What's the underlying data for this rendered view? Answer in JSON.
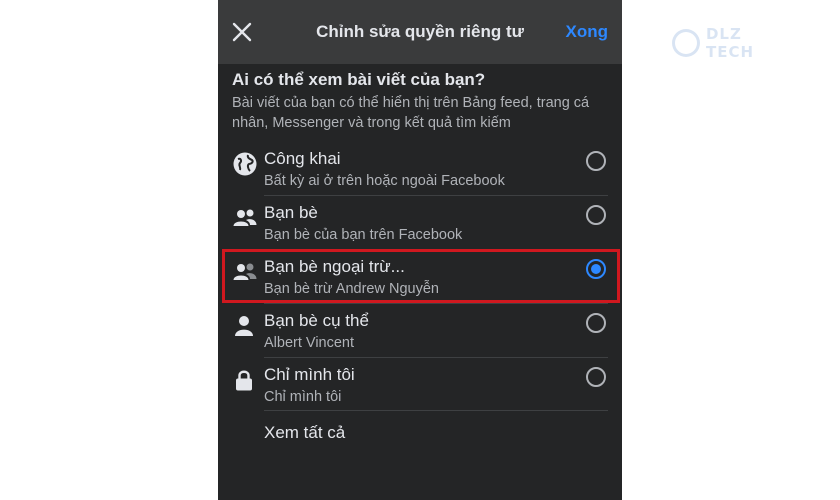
{
  "header": {
    "title": "Chỉnh sửa quyền riêng tư",
    "done_label": "Xong"
  },
  "prompt": {
    "question": "Ai có thể xem bài viết của bạn?",
    "description": "Bài viết của bạn có thể hiển thị trên Bảng feed, trang cá nhân, Messenger và trong kết quả tìm kiếm"
  },
  "options": [
    {
      "label": "Công khai",
      "sub": "Bất kỳ ai ở trên hoặc ngoài Facebook",
      "icon": "globe-icon",
      "selected": false
    },
    {
      "label": "Bạn bè",
      "sub": "Bạn bè của bạn trên Facebook",
      "icon": "friends-icon",
      "selected": false
    },
    {
      "label": "Bạn bè ngoại trừ...",
      "sub": "Bạn bè trừ Andrew Nguyễn",
      "icon": "friends-except-icon",
      "selected": true
    },
    {
      "label": "Bạn bè cụ thể",
      "sub": "Albert Vincent",
      "icon": "person-icon",
      "selected": false
    },
    {
      "label": "Chỉ mình tôi",
      "sub": "Chỉ mình tôi",
      "icon": "lock-icon",
      "selected": false
    }
  ],
  "see_all_label": "Xem tất cả",
  "watermark": "DLZ TECH",
  "colors": {
    "background": "#242526",
    "header_bg": "#3a3b3c",
    "accent": "#2d88ff",
    "highlight_border": "#d0181f"
  }
}
